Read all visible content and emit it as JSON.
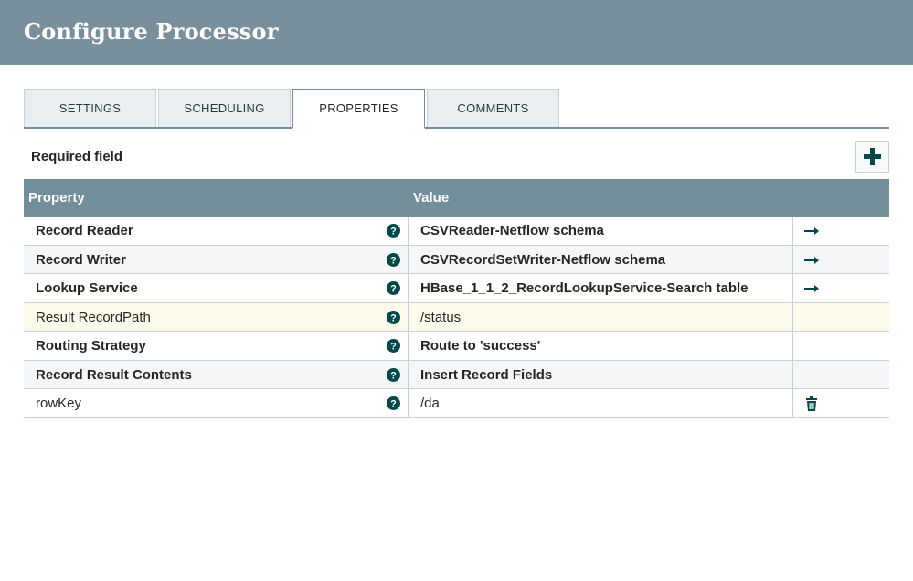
{
  "header": {
    "title": "Configure Processor"
  },
  "tabs": [
    {
      "label": "SETTINGS",
      "active": false
    },
    {
      "label": "SCHEDULING",
      "active": false
    },
    {
      "label": "PROPERTIES",
      "active": true
    },
    {
      "label": "COMMENTS",
      "active": false
    }
  ],
  "required_label": "Required field",
  "add_button_icon": "plus-icon",
  "grid": {
    "columns": [
      "Property",
      "Value"
    ],
    "rows": [
      {
        "property": "Record Reader",
        "value": "CSVReader-Netflow schema",
        "required": true,
        "action": "arrow-right-icon"
      },
      {
        "property": "Record Writer",
        "value": "CSVRecordSetWriter-Netflow schema",
        "required": true,
        "action": "arrow-right-icon"
      },
      {
        "property": "Lookup Service",
        "value": "HBase_1_1_2_RecordLookupService-Search table",
        "required": true,
        "action": "arrow-right-icon"
      },
      {
        "property": "Result RecordPath",
        "value": "/status",
        "required": false,
        "action": ""
      },
      {
        "property": "Routing Strategy",
        "value": "Route to 'success'",
        "required": true,
        "action": ""
      },
      {
        "property": "Record Result Contents",
        "value": "Insert Record Fields",
        "required": true,
        "action": ""
      },
      {
        "property": "rowKey",
        "value": "/da",
        "required": false,
        "action": "trash-icon"
      }
    ]
  },
  "colors": {
    "header_bg": "#7a8f9c",
    "grid_header_bg": "#728e9b",
    "icon": "#004849",
    "highlight_row": "#fcfaea"
  }
}
